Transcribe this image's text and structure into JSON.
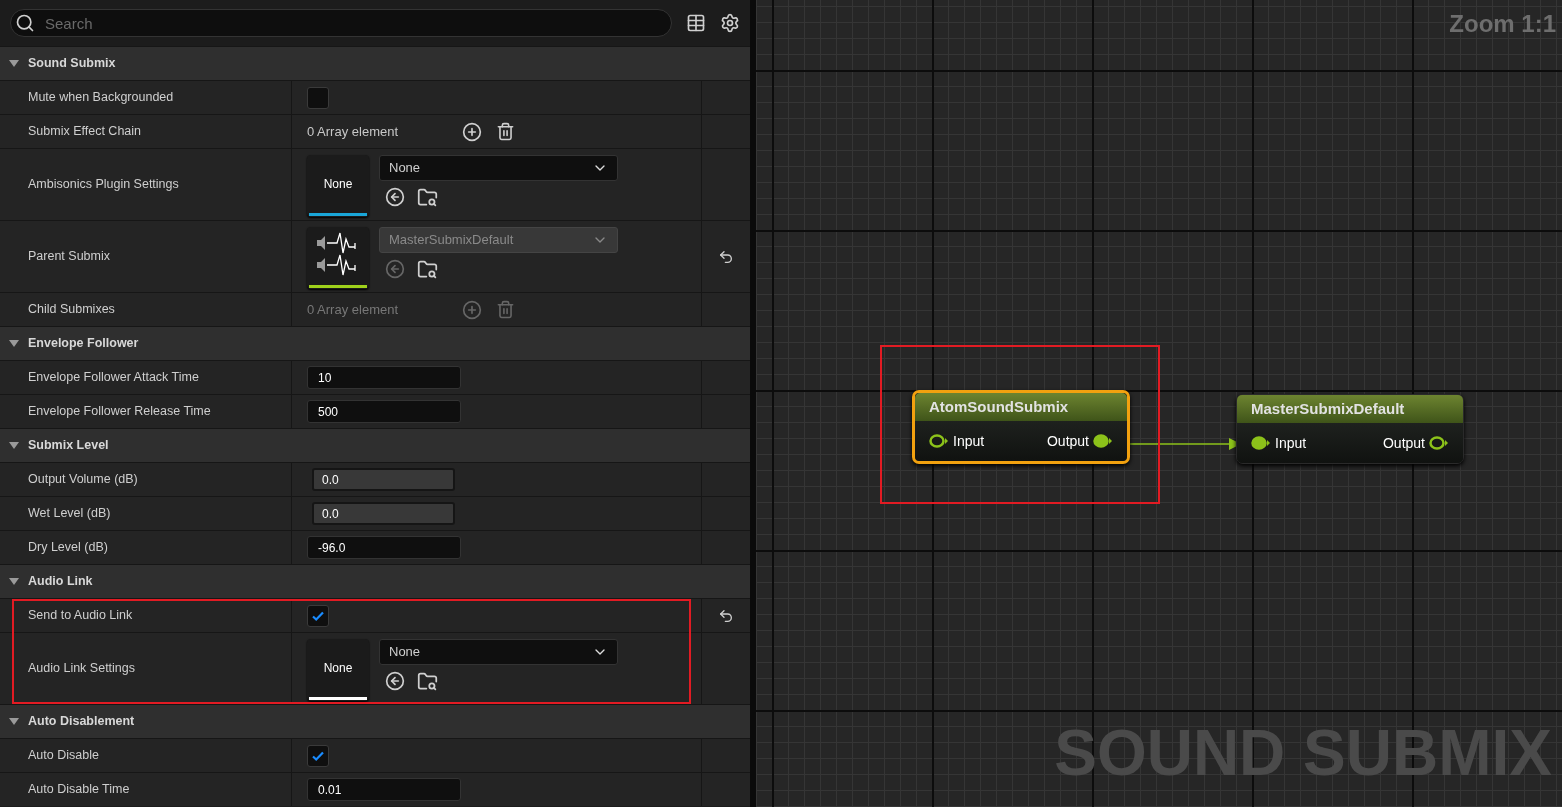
{
  "search": {
    "placeholder": "Search"
  },
  "sections": [
    {
      "title": "Sound Submix",
      "expanded": true,
      "rows": [
        {
          "kind": "checkbox",
          "label": "Mute when Backgrounded",
          "checked": false,
          "resettable": false,
          "highlighted": false
        },
        {
          "kind": "array",
          "label": "Submix Effect Chain",
          "value": "0 Array element",
          "disabled": false,
          "resettable": false,
          "highlighted": false
        },
        {
          "kind": "asset",
          "label": "Ambisonics Plugin Settings",
          "thumbnail": {
            "kind": "text",
            "text": "None"
          },
          "color": "#1aa6d8",
          "value": "None",
          "disabled": false,
          "resettable": false,
          "highlighted": false
        },
        {
          "kind": "asset",
          "label": "Parent Submix",
          "thumbnail": {
            "kind": "waveform"
          },
          "color": "#9fd11b",
          "value": "MasterSubmixDefault",
          "disabled": true,
          "resettable": true,
          "highlighted": false
        },
        {
          "kind": "array",
          "label": "Child Submixes",
          "value": "0 Array element",
          "disabled": true,
          "resettable": false,
          "highlighted": false
        }
      ]
    },
    {
      "title": "Envelope Follower",
      "expanded": true,
      "rows": [
        {
          "kind": "number",
          "label": "Envelope Follower Attack Time",
          "value": "10",
          "resettable": false,
          "highlighted": false
        },
        {
          "kind": "number",
          "label": "Envelope Follower Release Time",
          "value": "500",
          "resettable": false,
          "highlighted": false
        }
      ]
    },
    {
      "title": "Submix Level",
      "expanded": true,
      "rows": [
        {
          "kind": "slider",
          "label": "Output Volume (dB)",
          "value": "0.0",
          "resettable": false,
          "highlighted": false
        },
        {
          "kind": "slider",
          "label": "Wet Level (dB)",
          "value": "0.0",
          "resettable": false,
          "highlighted": false
        },
        {
          "kind": "number",
          "label": "Dry Level (dB)",
          "value": "-96.0",
          "resettable": false,
          "highlighted": false
        }
      ]
    },
    {
      "title": "Audio Link",
      "expanded": true,
      "rows": [
        {
          "kind": "checkbox",
          "label": "Send to Audio Link",
          "checked": true,
          "resettable": true,
          "highlighted": true
        },
        {
          "kind": "asset",
          "label": "Audio Link Settings",
          "thumbnail": {
            "kind": "text",
            "text": "None"
          },
          "color": "#ffffff",
          "value": "None",
          "disabled": false,
          "resettable": false,
          "highlighted": true
        }
      ]
    },
    {
      "title": "Auto Disablement",
      "expanded": true,
      "rows": [
        {
          "kind": "checkbox",
          "label": "Auto Disable",
          "checked": true,
          "resettable": false,
          "highlighted": false
        },
        {
          "kind": "number",
          "label": "Auto Disable Time",
          "value": "0.01",
          "resettable": false,
          "highlighted": false
        }
      ]
    }
  ],
  "graph": {
    "zoom": "Zoom 1:1",
    "title": "SOUND SUBMIX",
    "nodes": [
      {
        "title": "AtomSoundSubmix",
        "selected": true,
        "highlighted": true,
        "input": "Input",
        "output": "Output",
        "input_connected": false,
        "output_connected": true
      },
      {
        "title": "MasterSubmixDefault",
        "selected": false,
        "highlighted": false,
        "input": "Input",
        "output": "Output",
        "input_connected": true,
        "output_connected": false
      }
    ]
  }
}
